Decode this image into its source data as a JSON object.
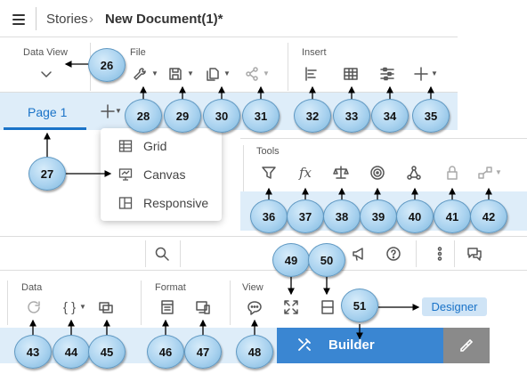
{
  "header": {
    "breadcrumb_parent": "Stories",
    "separator": "›",
    "title": "New Document(1)*"
  },
  "toolbar1": {
    "data_view_label": "Data View",
    "file_label": "File",
    "insert_label": "Insert"
  },
  "pages": {
    "active_tab": "Page 1"
  },
  "add_page_menu": {
    "items": [
      "Grid",
      "Canvas",
      "Responsive"
    ]
  },
  "tools": {
    "label": "Tools"
  },
  "toolbar3": {
    "data_label": "Data",
    "format_label": "Format",
    "view_label": "View",
    "builder_label": "Builder",
    "designer_label": "Designer"
  },
  "callouts": [
    "26",
    "27",
    "28",
    "29",
    "30",
    "31",
    "32",
    "33",
    "34",
    "35",
    "36",
    "37",
    "38",
    "39",
    "40",
    "41",
    "42",
    "43",
    "44",
    "45",
    "46",
    "47",
    "48",
    "49",
    "50",
    "51"
  ],
  "icons": [
    "hamburger-icon",
    "chevron-down-icon",
    "wrench-icon",
    "save-icon",
    "copy-icon",
    "share-icon",
    "align-left-icon",
    "table-icon",
    "filter-sliders-icon",
    "plus-icon",
    "funnel-icon",
    "fx-icon",
    "balance-icon",
    "target-icon",
    "network-icon",
    "lock-icon",
    "chain-icon",
    "refresh-icon",
    "braces-icon",
    "duplicate-icon",
    "layout-icon",
    "devices-icon",
    "comment-icon",
    "expand-icon",
    "split-icon",
    "search-icon",
    "megaphone-icon",
    "help-icon",
    "more-vertical-icon",
    "chat-icon",
    "tools-icon",
    "paint-icon"
  ],
  "colors": {
    "accent_bar": "#deedf9",
    "tab_blue": "#1a73c8",
    "builder_bg": "#3a86d2",
    "designer_bg": "#cfe4f6",
    "bubble": "#a9d2ef"
  }
}
